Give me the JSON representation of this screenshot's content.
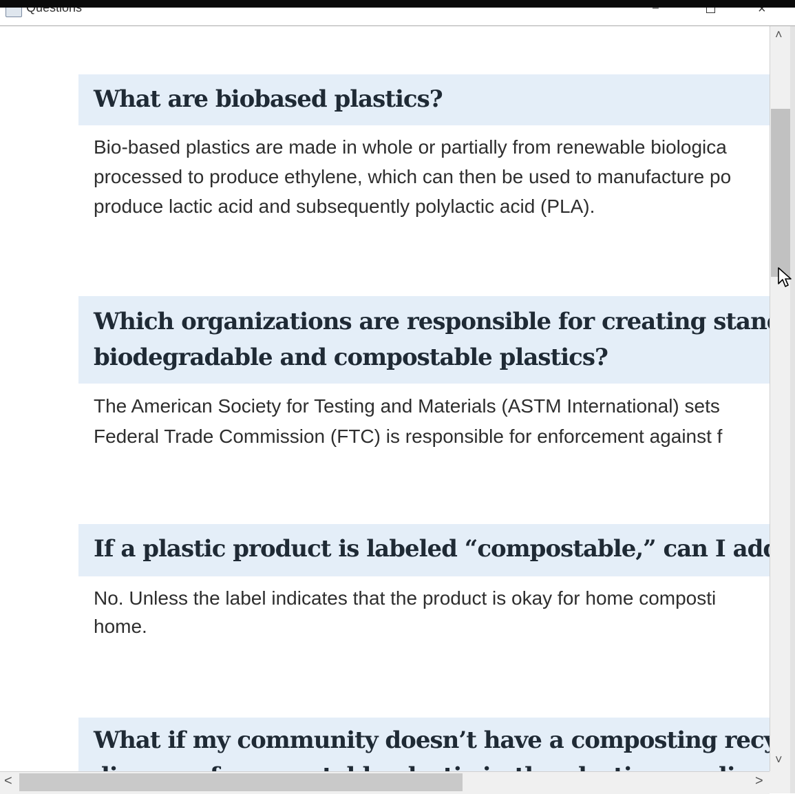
{
  "window": {
    "title": "Questions",
    "minimize_icon": "minimize-icon",
    "maximize_icon": "maximize-icon",
    "close_icon": "close-icon"
  },
  "faq": [
    {
      "question_lines": [
        "What are biobased plastics?"
      ],
      "answer_lines": [
        "Bio-based plastics are made in whole or partially from renewable biologica",
        "processed to produce ethylene, which can then be used to manufacture po",
        "produce lactic acid and subsequently polylactic acid (PLA)."
      ]
    },
    {
      "question_lines": [
        "Which organizations are responsible for creating standard",
        "biodegradable and compostable plastics?"
      ],
      "answer_lines": [
        "The American Society for Testing and Materials (ASTM International) sets",
        "Federal Trade Commission (FTC) is responsible for enforcement against f"
      ]
    },
    {
      "question_lines": [
        "If a plastic product is labeled “compostable,” can I add it to"
      ],
      "answer_lines": [
        " No. Unless the label indicates that the product is okay for home composti",
        "home."
      ]
    },
    {
      "question_lines": [
        "What if my community doesn’t have a composting recyclin",
        "dispose of compostable plastic in the plastic recycling pick"
      ],
      "answer_lines": []
    }
  ],
  "scrollbars": {
    "up_arrow": "˄",
    "down_arrow": "˅",
    "left_arrow": "<",
    "right_arrow": ">"
  }
}
